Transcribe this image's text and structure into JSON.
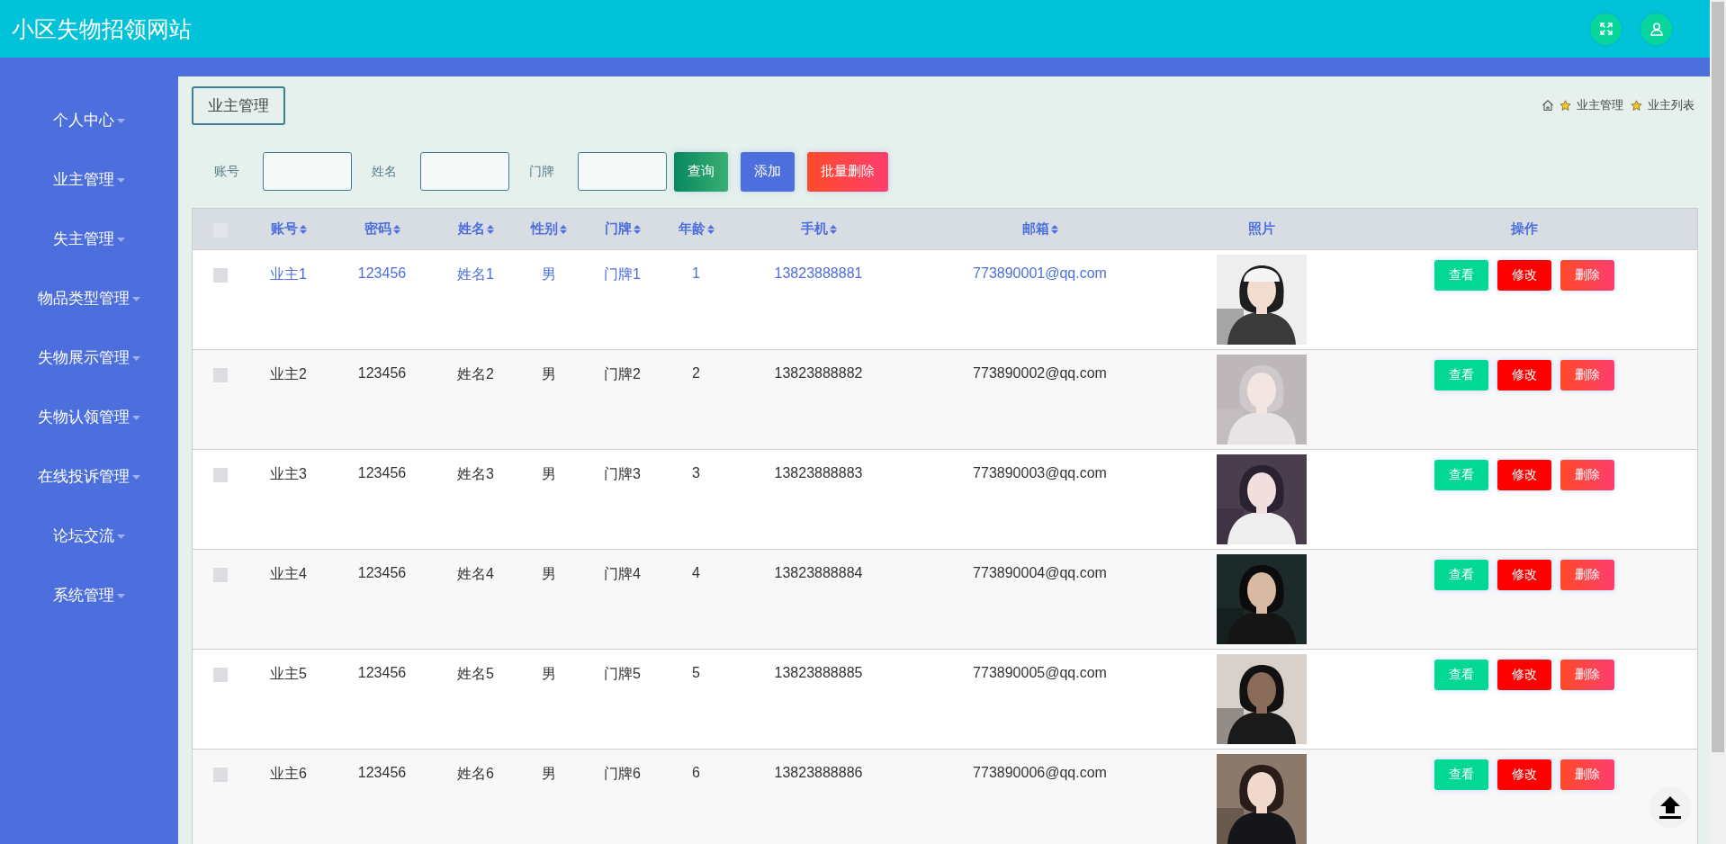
{
  "header": {
    "title": "小区失物招领网站"
  },
  "sidebar": {
    "items": [
      {
        "label": "个人中心"
      },
      {
        "label": "业主管理"
      },
      {
        "label": "失主管理"
      },
      {
        "label": "物品类型管理"
      },
      {
        "label": "失物展示管理"
      },
      {
        "label": "失物认领管理"
      },
      {
        "label": "在线投诉管理"
      },
      {
        "label": "论坛交流"
      },
      {
        "label": "系统管理"
      }
    ]
  },
  "page_tab": "业主管理",
  "breadcrumb": [
    "业主管理",
    "业主列表"
  ],
  "search": {
    "fields": [
      {
        "label": "账号"
      },
      {
        "label": "姓名"
      },
      {
        "label": "门牌"
      }
    ],
    "buttons": [
      {
        "label": "查询",
        "kind": "query"
      },
      {
        "label": "添加",
        "kind": "add"
      },
      {
        "label": "批量删除",
        "kind": "delete"
      }
    ]
  },
  "table": {
    "select_all": {
      "checked": false
    },
    "columns": [
      {
        "label": "账号",
        "sortable": true
      },
      {
        "label": "密码",
        "sortable": true
      },
      {
        "label": "姓名",
        "sortable": true
      },
      {
        "label": "性别",
        "sortable": true
      },
      {
        "label": "门牌",
        "sortable": true
      },
      {
        "label": "年龄",
        "sortable": true
      },
      {
        "label": "手机",
        "sortable": true
      },
      {
        "label": "邮箱",
        "sortable": true
      },
      {
        "label": "照片",
        "sortable": false
      },
      {
        "label": "操作",
        "sortable": false
      }
    ],
    "rows": [
      {
        "checked": false,
        "hovered": true,
        "cells": [
          "业主1",
          "123456",
          "姓名1",
          "男",
          "门牌1",
          "1",
          "13823888881",
          "773890001@qq.com"
        ],
        "photo": {
          "kind": "picture"
        },
        "actions": [
          {
            "label": "查看",
            "kind": "view"
          },
          {
            "label": "修改",
            "kind": "edit"
          },
          {
            "label": "删除",
            "kind": "delete"
          }
        ]
      },
      {
        "checked": false,
        "hovered": false,
        "cells": [
          "业主2",
          "123456",
          "姓名2",
          "男",
          "门牌2",
          "2",
          "13823888882",
          "773890002@qq.com"
        ],
        "photo": {
          "kind": "picture"
        },
        "actions": [
          {
            "label": "查看",
            "kind": "view"
          },
          {
            "label": "修改",
            "kind": "edit"
          },
          {
            "label": "删除",
            "kind": "delete"
          }
        ]
      },
      {
        "checked": false,
        "hovered": false,
        "cells": [
          "业主3",
          "123456",
          "姓名3",
          "男",
          "门牌3",
          "3",
          "13823888883",
          "773890003@qq.com"
        ],
        "photo": {
          "kind": "picture"
        },
        "actions": [
          {
            "label": "查看",
            "kind": "view"
          },
          {
            "label": "修改",
            "kind": "edit"
          },
          {
            "label": "删除",
            "kind": "delete"
          }
        ]
      },
      {
        "checked": false,
        "hovered": false,
        "cells": [
          "业主4",
          "123456",
          "姓名4",
          "男",
          "门牌4",
          "4",
          "13823888884",
          "773890004@qq.com"
        ],
        "photo": {
          "kind": "picture"
        },
        "actions": [
          {
            "label": "查看",
            "kind": "view"
          },
          {
            "label": "修改",
            "kind": "edit"
          },
          {
            "label": "删除",
            "kind": "delete"
          }
        ]
      },
      {
        "checked": false,
        "hovered": false,
        "cells": [
          "业主5",
          "123456",
          "姓名5",
          "男",
          "门牌5",
          "5",
          "13823888885",
          "773890005@qq.com"
        ],
        "photo": {
          "kind": "picture"
        },
        "actions": [
          {
            "label": "查看",
            "kind": "view"
          },
          {
            "label": "修改",
            "kind": "edit"
          },
          {
            "label": "删除",
            "kind": "delete"
          }
        ]
      },
      {
        "checked": false,
        "hovered": false,
        "cells": [
          "业主6",
          "123456",
          "姓名6",
          "男",
          "门牌6",
          "6",
          "13823888886",
          "773890006@qq.com"
        ],
        "photo": {
          "kind": "picture"
        },
        "actions": [
          {
            "label": "查看",
            "kind": "view"
          },
          {
            "label": "修改",
            "kind": "edit"
          },
          {
            "label": "删除",
            "kind": "delete"
          }
        ]
      }
    ]
  }
}
